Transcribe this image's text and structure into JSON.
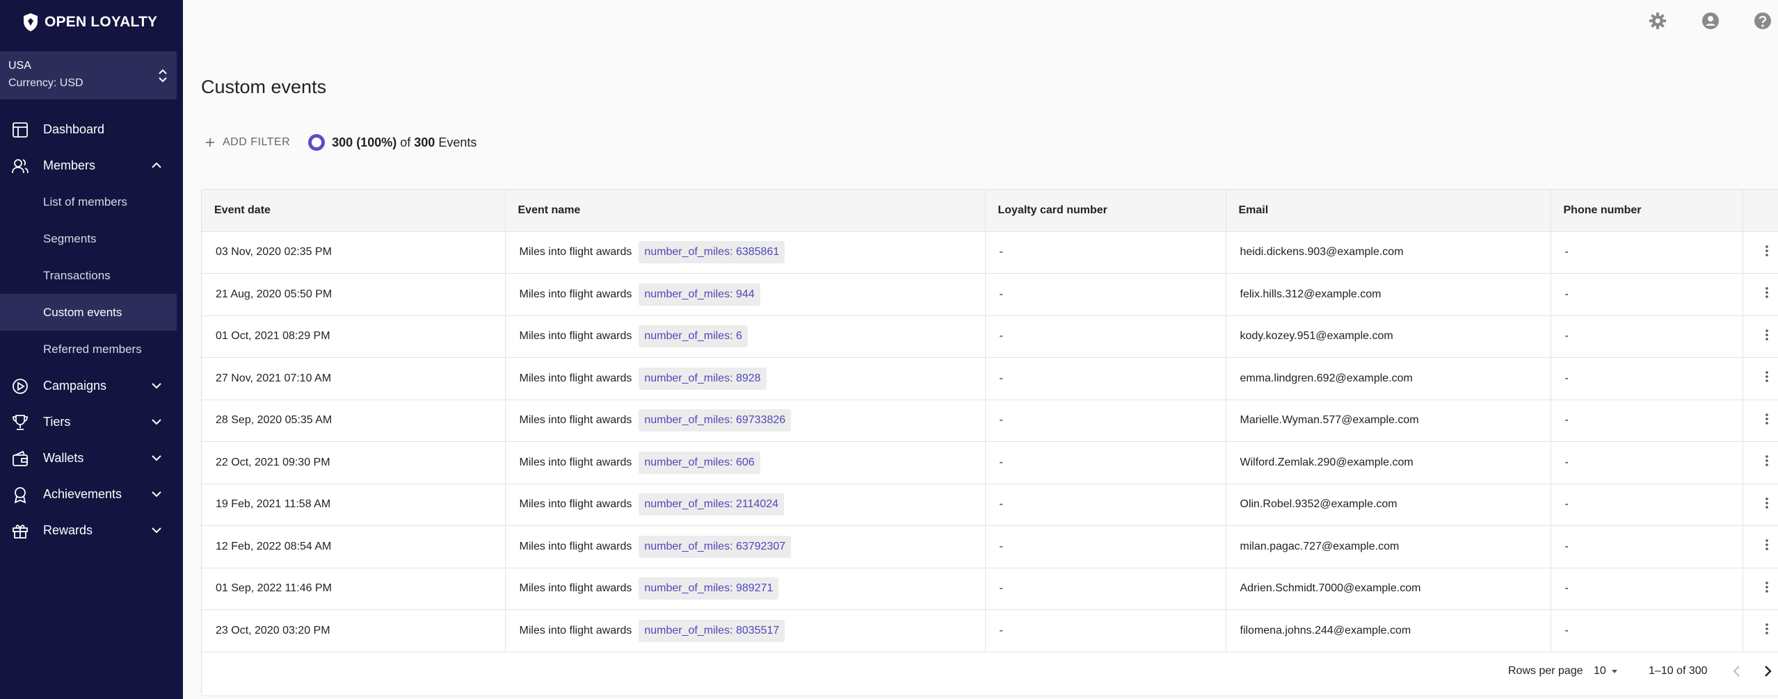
{
  "brand": {
    "name": "OPEN LOYALTY"
  },
  "region": {
    "name": "USA",
    "currency": "Currency: USD"
  },
  "sidebar": {
    "items": [
      {
        "label": "Dashboard",
        "icon": "dashboard-icon"
      },
      {
        "label": "Members",
        "icon": "members-icon",
        "expanded": true,
        "children": [
          "List of members",
          "Segments",
          "Transactions",
          "Custom events",
          "Referred members"
        ],
        "active_child": "Custom events"
      },
      {
        "label": "Campaigns",
        "icon": "campaigns-icon"
      },
      {
        "label": "Tiers",
        "icon": "trophy-icon"
      },
      {
        "label": "Wallets",
        "icon": "wallet-icon"
      },
      {
        "label": "Achievements",
        "icon": "achievement-icon"
      },
      {
        "label": "Rewards",
        "icon": "gift-icon"
      }
    ]
  },
  "topbar": {
    "icons": [
      "gear-icon",
      "account-icon",
      "help-icon"
    ]
  },
  "page": {
    "title": "Custom events",
    "add_filter": "ADD FILTER",
    "count": {
      "shown": "300 (100%)",
      "of": "of",
      "total": "300",
      "unit": "Events"
    }
  },
  "table": {
    "columns": [
      "Event date",
      "Event name",
      "Loyalty card number",
      "Email",
      "Phone number"
    ],
    "rows": [
      {
        "date": "03 Nov, 2020 02:35 PM",
        "event": "Miles into flight awards",
        "tag": "number_of_miles: 6385861",
        "card": "-",
        "email": "heidi.dickens.903@example.com",
        "phone": "-"
      },
      {
        "date": "21 Aug, 2020 05:50 PM",
        "event": "Miles into flight awards",
        "tag": "number_of_miles: 944",
        "card": "-",
        "email": "felix.hills.312@example.com",
        "phone": "-"
      },
      {
        "date": "01 Oct, 2021 08:29 PM",
        "event": "Miles into flight awards",
        "tag": "number_of_miles: 6",
        "card": "-",
        "email": "kody.kozey.951@example.com",
        "phone": "-"
      },
      {
        "date": "27 Nov, 2021 07:10 AM",
        "event": "Miles into flight awards",
        "tag": "number_of_miles: 8928",
        "card": "-",
        "email": "emma.lindgren.692@example.com",
        "phone": "-"
      },
      {
        "date": "28 Sep, 2020 05:35 AM",
        "event": "Miles into flight awards",
        "tag": "number_of_miles: 69733826",
        "card": "-",
        "email": "Marielle.Wyman.577@example.com",
        "phone": "-"
      },
      {
        "date": "22 Oct, 2021 09:30 PM",
        "event": "Miles into flight awards",
        "tag": "number_of_miles: 606",
        "card": "-",
        "email": "Wilford.Zemlak.290@example.com",
        "phone": "-"
      },
      {
        "date": "19 Feb, 2021 11:58 AM",
        "event": "Miles into flight awards",
        "tag": "number_of_miles: 2114024",
        "card": "-",
        "email": "Olin.Robel.9352@example.com",
        "phone": "-"
      },
      {
        "date": "12 Feb, 2022 08:54 AM",
        "event": "Miles into flight awards",
        "tag": "number_of_miles: 63792307",
        "card": "-",
        "email": "milan.pagac.727@example.com",
        "phone": "-"
      },
      {
        "date": "01 Sep, 2022 11:46 PM",
        "event": "Miles into flight awards",
        "tag": "number_of_miles: 989271",
        "card": "-",
        "email": "Adrien.Schmidt.7000@example.com",
        "phone": "-"
      },
      {
        "date": "23 Oct, 2020 03:20 PM",
        "event": "Miles into flight awards",
        "tag": "number_of_miles: 8035517",
        "card": "-",
        "email": "filomena.johns.244@example.com",
        "phone": "-"
      }
    ]
  },
  "pagination": {
    "rows_per_page_label": "Rows per page",
    "rows_per_page": "10",
    "range": "1–10 of 300"
  },
  "colors": {
    "sidebar_bg": "#13143f",
    "sidebar_active": "#2c2d5a",
    "accent": "#5b4fc3",
    "tag_text": "#4e48b8"
  }
}
